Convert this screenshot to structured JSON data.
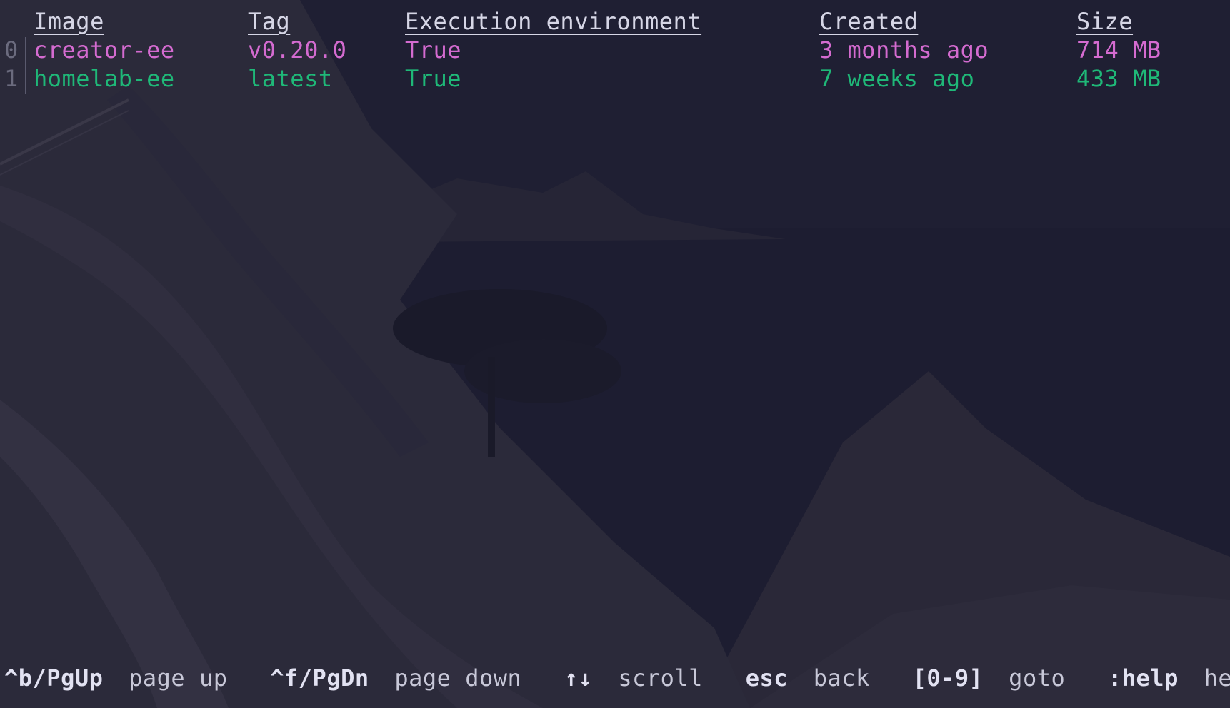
{
  "colors": {
    "background": "#1f1f33",
    "header": "#d6d6e6",
    "row_0": "#d46bd0",
    "row_1": "#1fb878",
    "index": "#6b6b7e"
  },
  "table": {
    "headers": {
      "image": "Image",
      "tag": "Tag",
      "exec": "Execution environment",
      "created": "Created",
      "size": "Size"
    },
    "rows": [
      {
        "index": "0",
        "image": "creator-ee",
        "tag": "v0.20.0",
        "exec": "True",
        "created": "3 months ago",
        "size": "714 MB"
      },
      {
        "index": "1",
        "image": "homelab-ee",
        "tag": "latest",
        "exec": "True",
        "created": "7 weeks ago",
        "size": "433 MB"
      }
    ]
  },
  "footer": {
    "items": [
      {
        "key": "^b/PgUp",
        "desc": "page up"
      },
      {
        "key": "^f/PgDn",
        "desc": "page down"
      },
      {
        "key": "↑↓",
        "desc": "scroll"
      },
      {
        "key": "esc",
        "desc": "back"
      },
      {
        "key": "[0-9]",
        "desc": "goto"
      },
      {
        "key": ":help",
        "desc": "help"
      }
    ]
  }
}
